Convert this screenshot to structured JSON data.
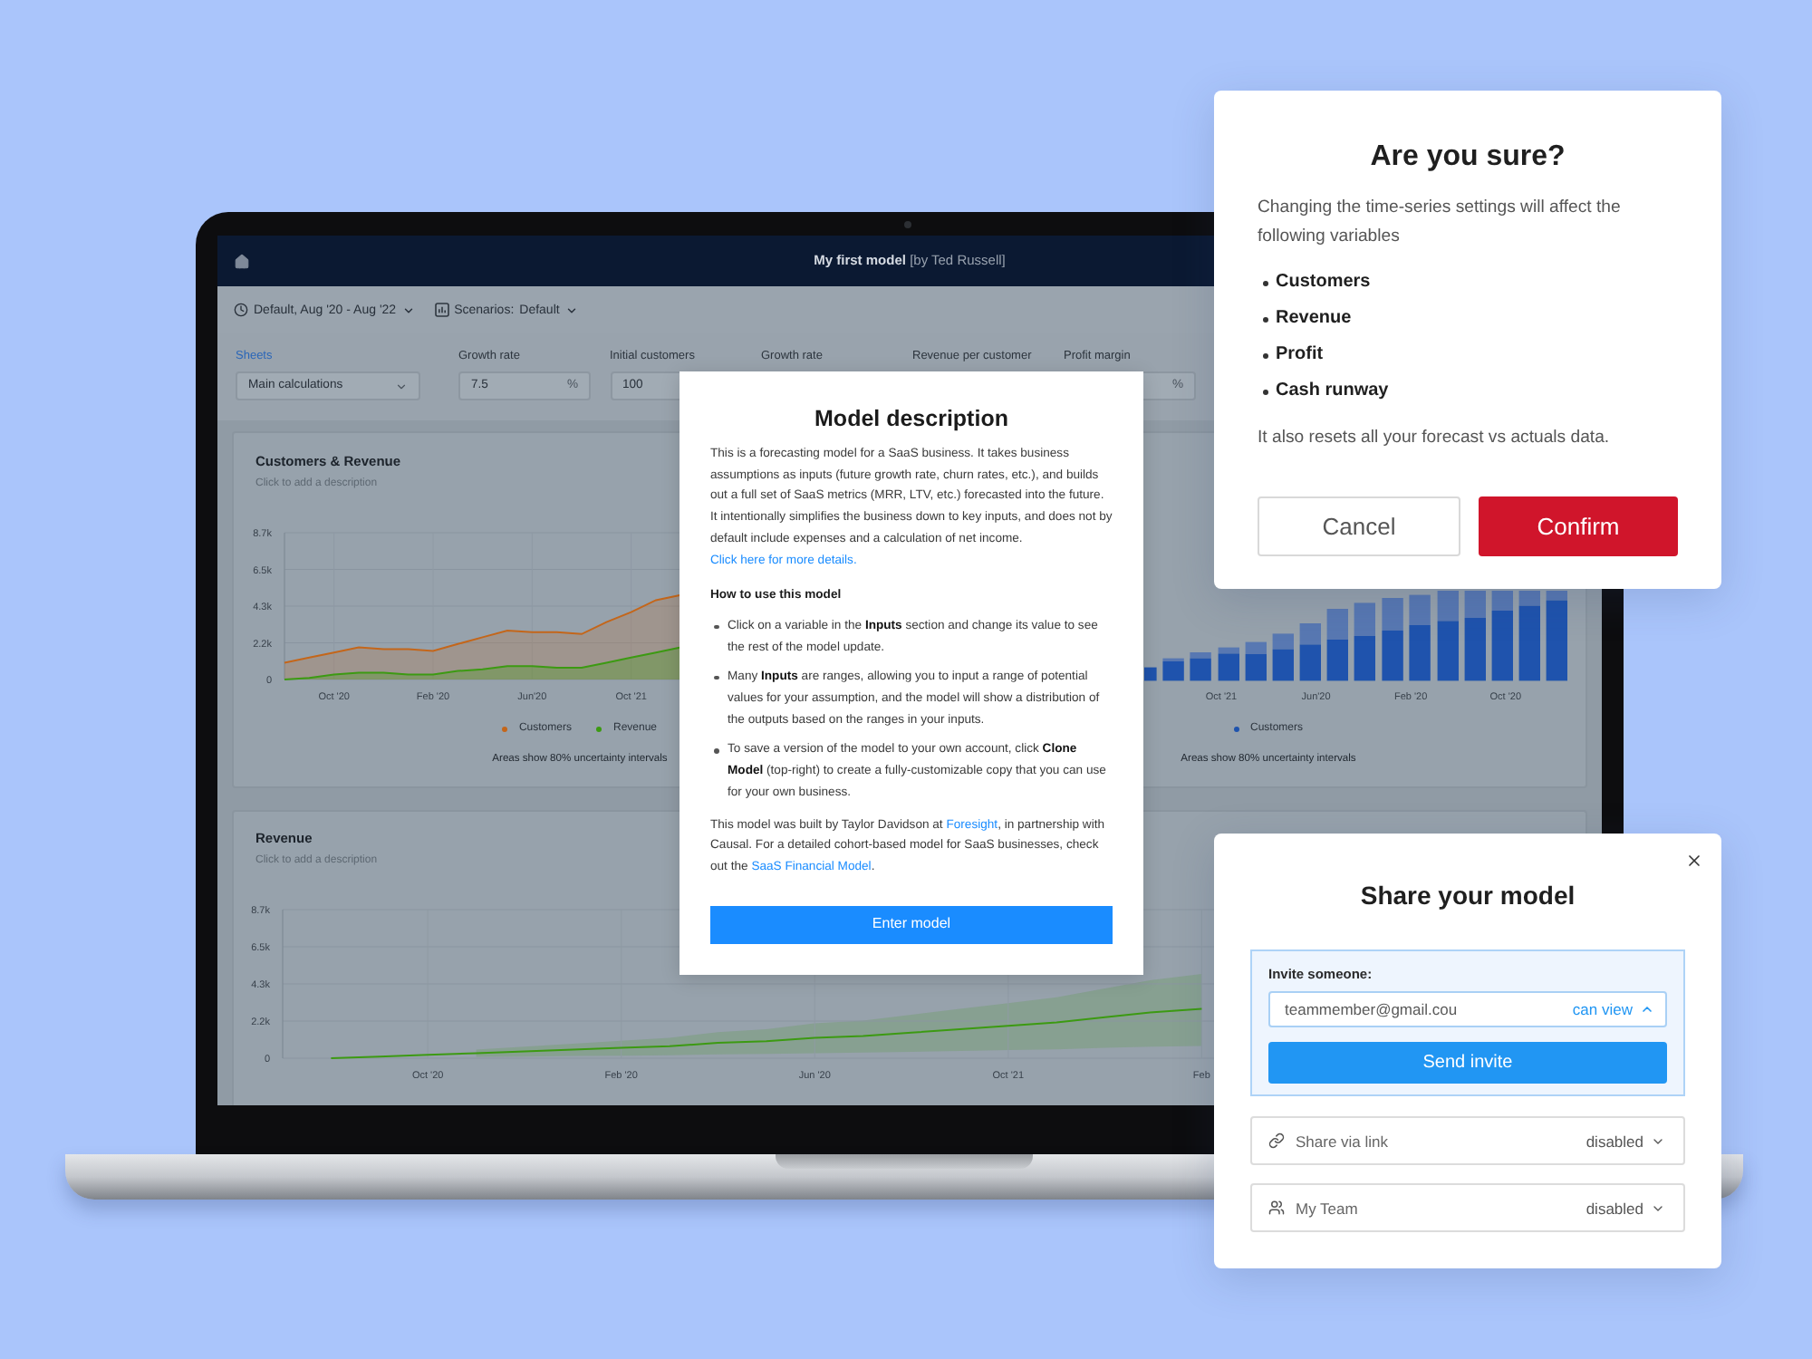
{
  "laptop_screen": {
    "header": {
      "title": "My first model",
      "byline": "[by Ted Russell]"
    },
    "toolbar": {
      "time_range": "Default, Aug '20 - Aug '22",
      "scenarios_label": "Scenarios:",
      "scenario": "Default"
    },
    "sheets": {
      "label": "Sheets",
      "value": "Main calculations"
    },
    "inputs": [
      {
        "label": "Growth rate",
        "value": "7.5",
        "unit": "%"
      },
      {
        "label": "Initial customers",
        "value": "100"
      },
      {
        "label": "Growth rate"
      },
      {
        "label": "Revenue per customer"
      },
      {
        "label": "Profit margin",
        "unit": "%"
      }
    ],
    "customers_revenue_card": {
      "title": "Customers & Revenue",
      "description": "Click to add a description",
      "chart_data": {
        "type": "area",
        "grid": true,
        "categories": [
          null,
          null,
          "Oct '20",
          null,
          null,
          null,
          "Feb '20",
          null,
          null,
          null,
          "Jun'20",
          null,
          null,
          null,
          "Oct '21",
          null,
          null,
          null,
          null,
          null,
          null,
          null,
          null,
          null,
          null
        ],
        "ylim": [
          0,
          8.7
        ],
        "yticks": [
          0,
          {
            "value": 2.175,
            "label": "2.2k"
          },
          {
            "value": 4.35,
            "label": "4.3k"
          },
          {
            "value": 6.525,
            "label": "6.5k"
          },
          {
            "value": 8.7,
            "label": "8.7k"
          }
        ],
        "series": [
          {
            "name": "Customers",
            "color": "#c4661a",
            "values": [
              1.0,
              1.3,
              1.6,
              1.9,
              1.8,
              1.8,
              1.7,
              2.1,
              2.5,
              2.9,
              2.8,
              2.8,
              2.7,
              3.4,
              4.0,
              4.7,
              5.0,
              null,
              null,
              null,
              null,
              null,
              null,
              null,
              null
            ]
          },
          {
            "name": "Revenue",
            "color": "#3c9a12",
            "values": [
              0,
              0.1,
              0.3,
              0.4,
              0.4,
              0.3,
              0.3,
              0.5,
              0.6,
              0.8,
              0.8,
              0.7,
              0.7,
              1.0,
              1.3,
              1.6,
              1.9,
              null,
              null,
              null,
              null,
              null,
              null,
              null,
              null
            ]
          }
        ]
      },
      "note": "Areas show 80% uncertainty intervals"
    },
    "customers_bar_card": {
      "x_labels": [
        "Oct '21",
        "Jun'20",
        "Feb '20",
        "Oct '20"
      ],
      "legend": [
        "Customers"
      ],
      "note": "Areas show 80% uncertainty intervals"
    },
    "revenue_card": {
      "title": "Revenue",
      "description": "Click to add a description",
      "chart_data": {
        "type": "line",
        "grid": true,
        "categories": [
          null,
          null,
          null,
          "Oct '20",
          null,
          null,
          null,
          "Feb '20",
          null,
          null,
          null,
          "Jun '20",
          null,
          null,
          null,
          "Oct '21",
          null,
          null,
          null,
          "Feb",
          null,
          null,
          null,
          null,
          null,
          null,
          null
        ],
        "ylim": [
          0,
          8.7
        ],
        "yticks": [
          0,
          {
            "value": 2.175,
            "label": "2.2k"
          },
          {
            "value": 4.35,
            "label": "4.3k"
          },
          {
            "value": 6.525,
            "label": "6.5k"
          },
          {
            "value": 8.7,
            "label": "8.7k"
          }
        ],
        "series": [
          {
            "color": "#3c9a12",
            "values": [
              null,
              0,
              0.1,
              0.2,
              0.3,
              0.4,
              0.5,
              0.6,
              0.7,
              0.9,
              1.0,
              1.2,
              1.3,
              1.5,
              1.7,
              1.9,
              2.1,
              2.4,
              2.7,
              2.9,
              null,
              null,
              null,
              null,
              null,
              null,
              null
            ]
          }
        ]
      }
    }
  },
  "model_description_dialog": {
    "title": "Model description",
    "intro": [
      {
        "kind": "text",
        "text": "This is a forecasting model for a SaaS business. It takes business assumptions as inputs (future growth rate, churn rates, etc.), and builds out a full set of SaaS metrics (MRR, LTV, etc.) forecasted into the future. It intentionally simplifies the business down to key inputs, and does not by default include expenses and a calculation of net income. "
      },
      {
        "kind": "link",
        "text": "Click here for more details."
      }
    ],
    "howto_heading": "How to use this model",
    "steps": [
      "Click on a variable in the **Inputs** section and change its value to see the rest of the model update.",
      "Many **Inputs** are ranges, allowing you to input a range of potential values for your assumption, and the model will show a distribution of the outputs based on the ranges in your inputs.",
      "To save a version of the model to your own account, click **Clone Model** (top-right) to create a fully-customizable copy that you can use for your own business."
    ],
    "credits": [
      {
        "kind": "text",
        "text": "This model was built by Taylor Davidson at "
      },
      {
        "kind": "link",
        "text": "Foresight"
      },
      {
        "kind": "text",
        "text": ", in partnership with Causal. For a detailed cohort-based model for SaaS businesses, check out the "
      },
      {
        "kind": "link",
        "text": "SaaS Financial Model"
      },
      {
        "kind": "text",
        "text": "."
      }
    ],
    "button": "Enter model"
  },
  "confirm_dialog": {
    "title": "Are you sure?",
    "message": "Changing the time-series settings will affect the following variables",
    "variables": [
      "Customers",
      "Revenue",
      "Profit",
      "Cash runway"
    ],
    "footnote": "It also resets all your forecast vs actuals data.",
    "buttons": [
      {
        "label": "Cancel",
        "kind": "secondary"
      },
      {
        "label": "Confirm",
        "kind": "primary"
      }
    ]
  },
  "share_dialog": {
    "title": "Share your model",
    "invite": {
      "label": "Invite someone:",
      "value": "teammember@gmail.cou",
      "permission": {
        "label": "can view",
        "expanded": true
      },
      "button": "Send invite"
    },
    "options": [
      {
        "label": "Share via link",
        "kind": "link",
        "value": "disabled",
        "expanded": false
      },
      {
        "label": "My Team",
        "kind": "team",
        "value": "disabled",
        "expanded": false
      }
    ]
  }
}
